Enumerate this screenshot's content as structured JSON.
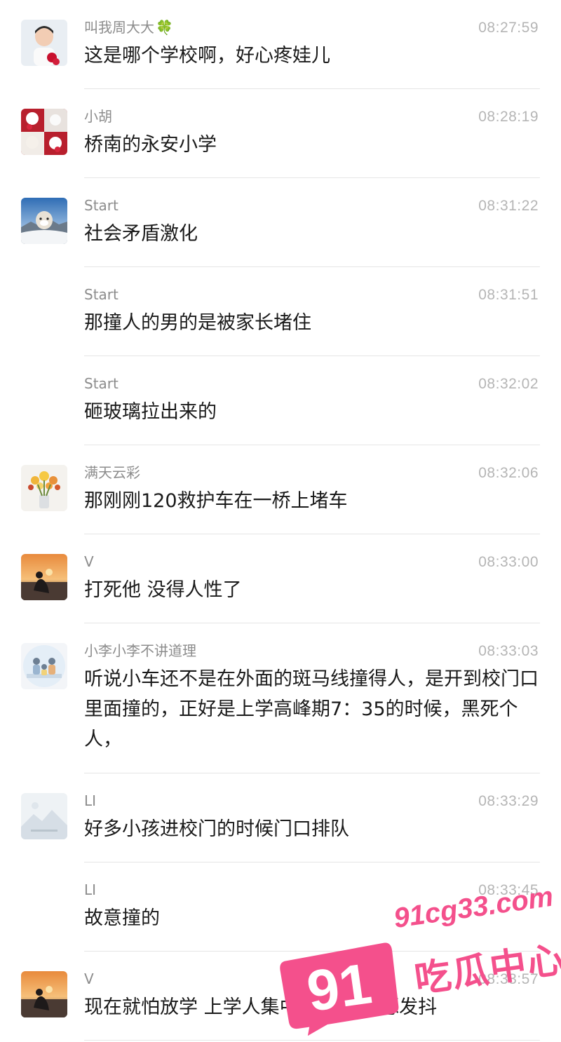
{
  "messages": [
    {
      "name": "叫我周大大",
      "badge": "🍀",
      "time": "08:27:59",
      "text": "这是哪个学校啊，好心疼娃儿",
      "avatar": "child-avatar"
    },
    {
      "name": "小胡",
      "badge": "",
      "time": "08:28:19",
      "text": "桥南的永安小学",
      "avatar": "plush-toy-avatar"
    },
    {
      "name": "Start",
      "badge": "",
      "time": "08:31:22",
      "text": "社会矛盾激化",
      "avatar": "snow-dog-avatar"
    },
    {
      "name": "Start",
      "badge": "",
      "time": "08:31:51",
      "text": "那撞人的男的是被家长堵住",
      "avatar": ""
    },
    {
      "name": "Start",
      "badge": "",
      "time": "08:32:02",
      "text": "砸玻璃拉出来的",
      "avatar": ""
    },
    {
      "name": "满天云彩",
      "badge": "",
      "time": "08:32:06",
      "text": "那刚刚120救护车在一桥上堵车",
      "avatar": "flowers-avatar"
    },
    {
      "name": "V",
      "badge": "",
      "time": "08:33:00",
      "text": "打死他 没得人性了",
      "avatar": "sunset-person-avatar"
    },
    {
      "name": "小李小李不讲道理",
      "badge": "",
      "time": "08:33:03",
      "text": "听说小车还不是在外面的斑马线撞得人，是开到校门口里面撞的，正好是上学高峰期7：35的时候，黑死个人，",
      "avatar": "family-avatar"
    },
    {
      "name": "LI",
      "badge": "",
      "time": "08:33:29",
      "text": "好多小孩进校门的时候门口排队",
      "avatar": "landscape-placeholder-avatar"
    },
    {
      "name": "LI",
      "badge": "",
      "time": "08:33:45",
      "text": "故意撞的",
      "avatar": ""
    },
    {
      "name": "V",
      "badge": "",
      "time": "08:33:57",
      "text": "现在就怕放学 上学人集中的时候 瑟瑟发抖",
      "avatar": "sunset-person-avatar"
    }
  ],
  "watermark": {
    "url": "91cg33.com",
    "number": "91",
    "label": "吃瓜中心",
    "color": "#f4508c"
  }
}
